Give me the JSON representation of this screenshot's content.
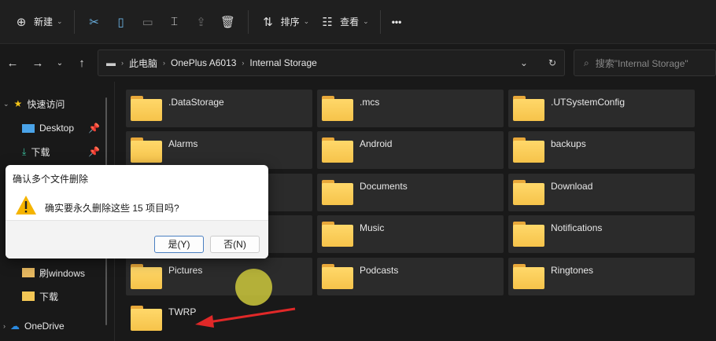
{
  "toolbar": {
    "new_label": "新建",
    "sort_label": "排序",
    "view_label": "查看",
    "more": "•••"
  },
  "address": {
    "segments": [
      "此电脑",
      "OnePlus A6013",
      "Internal Storage"
    ],
    "search_placeholder": "搜索\"Internal Storage\""
  },
  "sidebar": {
    "quick_access": "快速访问",
    "items": [
      {
        "label": "Desktop",
        "pinned": true
      },
      {
        "label": "下载",
        "pinned": true
      },
      {
        "label": "刷windows"
      },
      {
        "label": "下载"
      }
    ],
    "onedrive": "OneDrive"
  },
  "folders": [
    {
      "name": ".DataStorage",
      "selected": true
    },
    {
      "name": ".mcs",
      "selected": true
    },
    {
      "name": ".UTSystemConfig",
      "selected": true
    },
    {
      "name": "Alarms",
      "selected": true
    },
    {
      "name": "Android",
      "selected": true
    },
    {
      "name": "backups",
      "selected": true
    },
    {
      "name": "",
      "selected": true
    },
    {
      "name": "Documents",
      "selected": true
    },
    {
      "name": "Download",
      "selected": true
    },
    {
      "name": "",
      "selected": true
    },
    {
      "name": "Music",
      "selected": true
    },
    {
      "name": "Notifications",
      "selected": true
    },
    {
      "name": "Pictures",
      "selected": true
    },
    {
      "name": "Podcasts",
      "selected": true
    },
    {
      "name": "Ringtones",
      "selected": true
    },
    {
      "name": "TWRP",
      "selected": false
    }
  ],
  "dialog": {
    "title": "确认多个文件删除",
    "message": "确实要永久删除这些 15 项目吗?",
    "yes": "是(Y)",
    "no": "否(N)"
  },
  "colors": {
    "accent": "#4a7fc1",
    "folder": "#f6c34a",
    "arrow": "#e02828"
  }
}
